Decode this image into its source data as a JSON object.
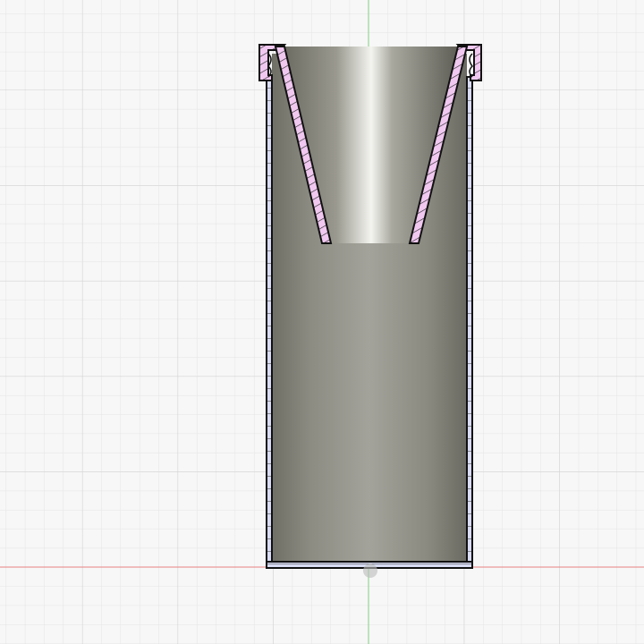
{
  "viewport": {
    "view": "section-analysis",
    "colors": {
      "background": "#f7f7f7",
      "grid_minor": "#e4e4e4",
      "grid_major": "#cfcfcf",
      "x_axis": "#e06060",
      "y_axis": "#60c060",
      "section_fill_funnel": "#f0c8f0",
      "section_fill_body": "#d8dcf4",
      "body_gray": "#8a8a80"
    }
  }
}
